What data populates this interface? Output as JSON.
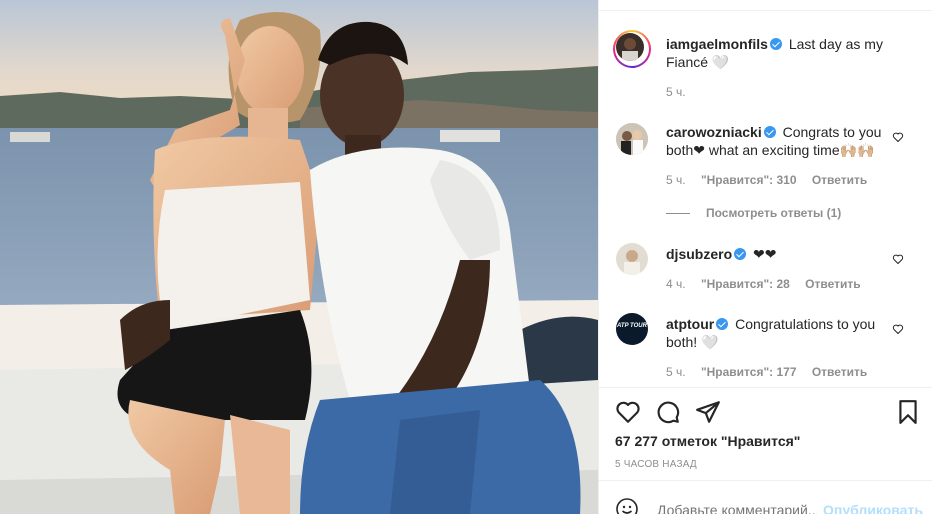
{
  "post": {
    "author": "iamgaelmonfils",
    "caption": "Last day as my Fiancé 🤍",
    "time": "5 ч."
  },
  "comments": [
    {
      "username": "carowozniacki",
      "text": "Congrats to you both❤ what an exciting time🙌🏼🙌🏼",
      "time": "5 ч.",
      "likes": "\"Нравится\": 310",
      "reply": "Ответить",
      "view_replies": "Посмотреть ответы (1)"
    },
    {
      "username": "djsubzero",
      "text": "❤❤",
      "time": "4 ч.",
      "likes": "\"Нравится\": 28",
      "reply": "Ответить"
    },
    {
      "username": "atptour",
      "text": "Congratulations to you both! 🤍",
      "time": "5 ч.",
      "likes": "\"Нравится\": 177",
      "reply": "Ответить",
      "avatar_text": "ATP TOUR"
    }
  ],
  "actions": {
    "like_icon": "heart-icon",
    "comment_icon": "comment-icon",
    "share_icon": "paper-plane-icon",
    "save_icon": "bookmark-icon"
  },
  "stats": {
    "likes": "67 277 отметок \"Нравится\"",
    "posted": "5 ЧАСОВ НАЗАД"
  },
  "composer": {
    "placeholder": "Добавьте комментарий...",
    "publish": "Опубликовать",
    "emoji_icon": "smiley-icon"
  },
  "colors": {
    "verified": "#3897f0",
    "muted": "#8e8e8e",
    "publish_disabled": "#b2dffc",
    "text": "#262626"
  }
}
